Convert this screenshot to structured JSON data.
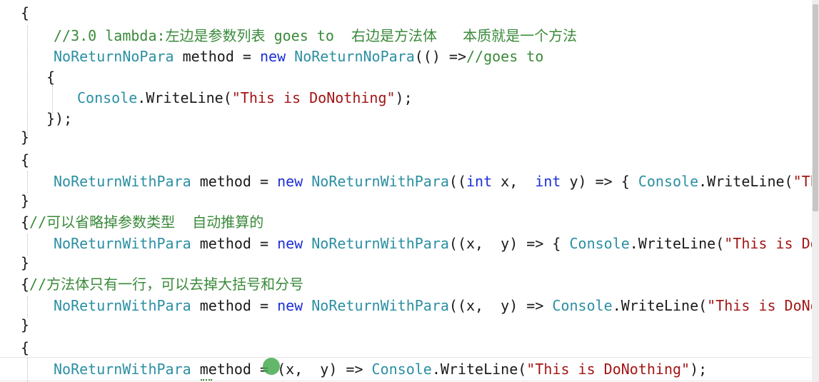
{
  "colors": {
    "keyword": "#1b2fd6",
    "type": "#2b8fa3",
    "comment": "#3a8a3a",
    "string": "#a31515",
    "text": "#1a1a1a",
    "cursor_highlight": "#46aa50"
  },
  "code_lines": [
    {
      "tokens": [
        {
          "text": "{",
          "kind": "pun"
        }
      ]
    },
    {
      "tokens": [
        {
          "text": "//3.0 lambda:左边是参数列表 goes to  右边是方法体   本质就是一个方法",
          "kind": "cmt"
        }
      ]
    },
    {
      "tokens": [
        {
          "text": "NoReturnNoPara",
          "kind": "type"
        },
        {
          "text": " method = ",
          "kind": "ident"
        },
        {
          "text": "new",
          "kind": "kw"
        },
        {
          "text": " ",
          "kind": "ident"
        },
        {
          "text": "NoReturnNoPara",
          "kind": "type"
        },
        {
          "text": "(() =>",
          "kind": "pun"
        },
        {
          "text": "//goes to",
          "kind": "cmt"
        }
      ]
    },
    {
      "tokens": [
        {
          "text": "{",
          "kind": "pun"
        }
      ]
    },
    {
      "tokens": [
        {
          "text": "Console",
          "kind": "type"
        },
        {
          "text": ".WriteLine(",
          "kind": "ident"
        },
        {
          "text": "\"This is DoNothing\"",
          "kind": "str"
        },
        {
          "text": ");",
          "kind": "pun"
        }
      ]
    },
    {
      "tokens": [
        {
          "text": "});",
          "kind": "pun"
        }
      ]
    },
    {
      "tokens": [
        {
          "text": "}",
          "kind": "pun"
        }
      ]
    },
    {
      "tokens": [
        {
          "text": "{",
          "kind": "pun"
        }
      ]
    },
    {
      "tokens": [
        {
          "text": "NoReturnWithPara",
          "kind": "type"
        },
        {
          "text": " method = ",
          "kind": "ident"
        },
        {
          "text": "new",
          "kind": "kw"
        },
        {
          "text": " ",
          "kind": "ident"
        },
        {
          "text": "NoReturnWithPara",
          "kind": "type"
        },
        {
          "text": "((",
          "kind": "pun"
        },
        {
          "text": "int",
          "kind": "kw"
        },
        {
          "text": " x,  ",
          "kind": "ident"
        },
        {
          "text": "int",
          "kind": "kw"
        },
        {
          "text": " y) => { ",
          "kind": "ident"
        },
        {
          "text": "Console",
          "kind": "type"
        },
        {
          "text": ".WriteLine(",
          "kind": "ident"
        },
        {
          "text": "\"This",
          "kind": "str"
        }
      ]
    },
    {
      "tokens": [
        {
          "text": "}",
          "kind": "pun"
        }
      ]
    },
    {
      "tokens": [
        {
          "text": "{",
          "kind": "pun"
        },
        {
          "text": "//可以省略掉参数类型  自动推算的",
          "kind": "cmt"
        }
      ]
    },
    {
      "tokens": [
        {
          "text": "NoReturnWithPara",
          "kind": "type"
        },
        {
          "text": " method = ",
          "kind": "ident"
        },
        {
          "text": "new",
          "kind": "kw"
        },
        {
          "text": " ",
          "kind": "ident"
        },
        {
          "text": "NoReturnWithPara",
          "kind": "type"
        },
        {
          "text": "((x,  y) => { ",
          "kind": "ident"
        },
        {
          "text": "Console",
          "kind": "type"
        },
        {
          "text": ".WriteLine(",
          "kind": "ident"
        },
        {
          "text": "\"This is DoNo",
          "kind": "str"
        }
      ]
    },
    {
      "tokens": [
        {
          "text": "}",
          "kind": "pun"
        }
      ]
    },
    {
      "tokens": [
        {
          "text": "{",
          "kind": "pun"
        },
        {
          "text": "//方法体只有一行，可以去掉大括号和分号",
          "kind": "cmt"
        }
      ]
    },
    {
      "tokens": [
        {
          "text": "NoReturnWithPara",
          "kind": "type"
        },
        {
          "text": " method = ",
          "kind": "ident"
        },
        {
          "text": "new",
          "kind": "kw"
        },
        {
          "text": " ",
          "kind": "ident"
        },
        {
          "text": "NoReturnWithPara",
          "kind": "type"
        },
        {
          "text": "((x,  y) => ",
          "kind": "ident"
        },
        {
          "text": "Console",
          "kind": "type"
        },
        {
          "text": ".WriteLine(",
          "kind": "ident"
        },
        {
          "text": "\"This is DoNoth",
          "kind": "str"
        }
      ]
    },
    {
      "tokens": [
        {
          "text": "}",
          "kind": "pun"
        }
      ]
    },
    {
      "tokens": [
        {
          "text": "{",
          "kind": "pun"
        }
      ]
    },
    {
      "tokens": [
        {
          "text": "NoReturnWithPara",
          "kind": "type"
        },
        {
          "text": " method = ",
          "kind": "ident"
        },
        {
          "text": "(x,  y) => ",
          "kind": "ident"
        },
        {
          "text": "Console",
          "kind": "type"
        },
        {
          "text": ".WriteLine(",
          "kind": "ident"
        },
        {
          "text": "\"This is DoNothing\"",
          "kind": "str"
        },
        {
          "text": ");",
          "kind": "pun"
        }
      ]
    }
  ]
}
